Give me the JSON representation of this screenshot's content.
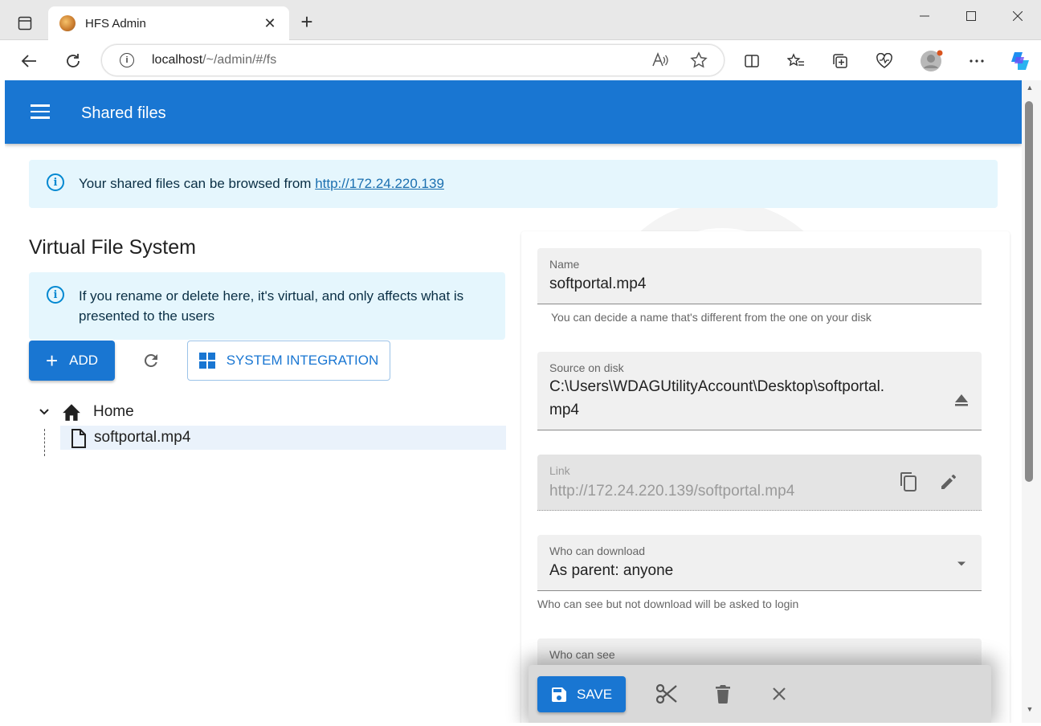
{
  "browser": {
    "tab_title": "HFS Admin",
    "tab_close": "✕",
    "new_tab": "+",
    "url_host": "localhost",
    "url_path": "/~/admin/#/fs"
  },
  "appbar": {
    "title": "Shared files"
  },
  "info_alert": {
    "text": "Your shared files can be browsed from ",
    "link": "http://172.24.220.139"
  },
  "vfs": {
    "title": "Virtual File System",
    "notice": "If you rename or delete here, it's virtual, and only affects what is presented to the users",
    "add_label": "ADD",
    "system_integration_label": "SYSTEM INTEGRATION",
    "tree": {
      "root": "Home",
      "children": [
        "softportal.mp4"
      ]
    }
  },
  "form": {
    "name": {
      "label": "Name",
      "value": "softportal.mp4",
      "helper": "You can decide a name that's different from the one on your disk"
    },
    "source": {
      "label": "Source on disk",
      "value_line1": "C:\\Users\\WDAGUtilityAccount\\Desktop\\softportal.",
      "value_line2": "mp4"
    },
    "link": {
      "label": "Link",
      "value": "http://172.24.220.139/softportal.mp4"
    },
    "can_download": {
      "label": "Who can download",
      "value": "As parent: anyone",
      "helper": "Who can see but not download will be asked to login"
    },
    "can_see": {
      "label": "Who can see"
    }
  },
  "actions": {
    "save_label": "SAVE"
  },
  "colors": {
    "primary": "#1976d2",
    "alert_bg": "#e5f6fd",
    "info_icon": "#0288d1"
  }
}
